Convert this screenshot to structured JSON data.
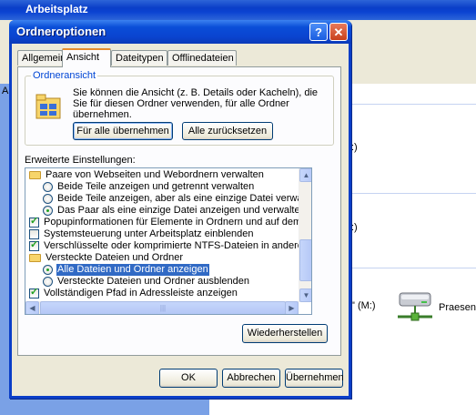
{
  "background": {
    "window_title": "Arbeitsplatz",
    "drive_labels": [
      ":)",
      ":)",
      "\" (M:)"
    ],
    "left_letter": "A",
    "network_drive_label": "Praesent"
  },
  "dialog": {
    "title": "Ordneroptionen",
    "help_label": "?",
    "close_label": "✕",
    "tabs": [
      "Allgemein",
      "Ansicht",
      "Dateitypen",
      "Offlinedateien"
    ],
    "active_tab": "Ansicht",
    "folder_view": {
      "legend": "Ordneransicht",
      "description": "Sie können die Ansicht (z. B. Details oder Kacheln), die Sie für diesen Ordner verwenden, für alle Ordner übernehmen.",
      "apply_all_label": "Für alle übernehmen",
      "reset_all_label": "Alle zurücksetzen"
    },
    "advanced_label": "Erweiterte Einstellungen:",
    "settings": [
      {
        "type": "folder",
        "label": "Paare von Webseiten und Webordnern verwalten"
      },
      {
        "type": "radio",
        "checked": false,
        "label": "Beide Teile anzeigen und getrennt verwalten"
      },
      {
        "type": "radio",
        "checked": false,
        "label": "Beide Teile anzeigen, aber als eine einzige Datei verwalten"
      },
      {
        "type": "radio",
        "checked": true,
        "label": "Das Paar als eine einzige Datei anzeigen und verwalten"
      },
      {
        "type": "check",
        "checked": true,
        "label": "Popupinformationen für Elemente in Ordnern und auf dem Desk"
      },
      {
        "type": "check",
        "checked": false,
        "label": "Systemsteuerung unter Arbeitsplatz einblenden"
      },
      {
        "type": "check",
        "checked": true,
        "label": "Verschlüsselte oder komprimierte NTFS-Dateien in anderer Fart"
      },
      {
        "type": "folder",
        "label": "Versteckte Dateien und Ordner"
      },
      {
        "type": "radio",
        "checked": true,
        "selected": true,
        "label": "Alle Dateien und Ordner anzeigen"
      },
      {
        "type": "radio",
        "checked": false,
        "label": "Versteckte Dateien und Ordner ausblenden"
      },
      {
        "type": "check",
        "checked": true,
        "label": "Vollständigen Pfad in Adressleiste anzeigen"
      }
    ],
    "restore_label": "Wiederherstellen",
    "ok_label": "OK",
    "cancel_label": "Abbrechen",
    "apply_label": "Übernehmen"
  }
}
